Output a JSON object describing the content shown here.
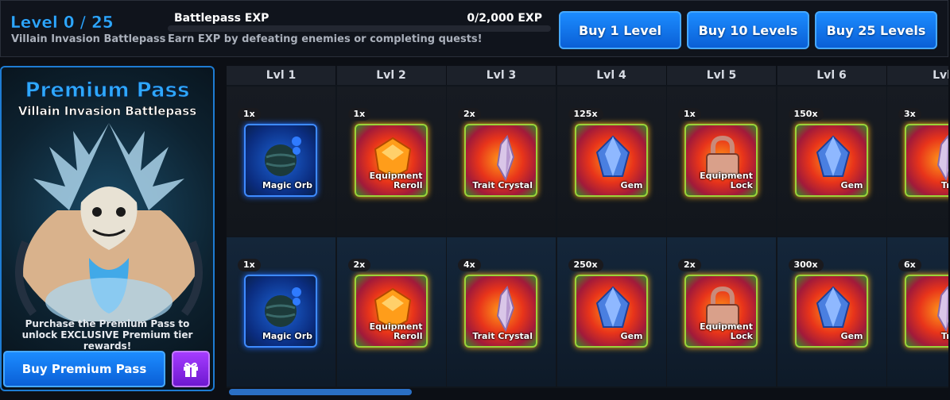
{
  "header": {
    "level_text": "Level 0 / 25",
    "battlepass_name": "Villain Invasion Battlepass",
    "exp_title": "Battlepass EXP",
    "exp_value": "0/2,000 EXP",
    "exp_progress": 0,
    "exp_description": "Earn EXP by defeating enemies or completing quests!",
    "buy_buttons": [
      "Buy 1 Level",
      "Buy 10 Levels",
      "Buy 25 Levels"
    ]
  },
  "premium": {
    "title": "Premium Pass",
    "subtitle": "Villain Invasion Battlepass",
    "description": "Purchase the Premium Pass to unlock EXCLUSIVE Premium tier rewards!",
    "buy_label": "Buy Premium Pass",
    "gift_icon": "gift-icon"
  },
  "colors": {
    "accent": "#2ea8ff",
    "button": "#0a5fd6",
    "gift": "#8a2be2"
  },
  "levels": [
    {
      "label": "Lvl 1",
      "free": {
        "qty": "1x",
        "name": "Magic Orb",
        "icon": "magic-orb-icon",
        "rarity": "blue"
      },
      "premium": {
        "qty": "1x",
        "name": "Magic Orb",
        "icon": "magic-orb-icon",
        "rarity": "blue"
      }
    },
    {
      "label": "Lvl 2",
      "free": {
        "qty": "1x",
        "name": "Equipment Reroll",
        "icon": "equipment-reroll-icon",
        "rarity": "rainbow"
      },
      "premium": {
        "qty": "2x",
        "name": "Equipment Reroll",
        "icon": "equipment-reroll-icon",
        "rarity": "rainbow"
      }
    },
    {
      "label": "Lvl 3",
      "free": {
        "qty": "2x",
        "name": "Trait Crystal",
        "icon": "trait-crystal-icon",
        "rarity": "rainbow"
      },
      "premium": {
        "qty": "4x",
        "name": "Trait Crystal",
        "icon": "trait-crystal-icon",
        "rarity": "rainbow"
      }
    },
    {
      "label": "Lvl 4",
      "free": {
        "qty": "125x",
        "name": "Gem",
        "icon": "gem-icon",
        "rarity": "rainbow"
      },
      "premium": {
        "qty": "250x",
        "name": "Gem",
        "icon": "gem-icon",
        "rarity": "rainbow"
      }
    },
    {
      "label": "Lvl 5",
      "free": {
        "qty": "1x",
        "name": "Equipment Lock",
        "icon": "equipment-lock-icon",
        "rarity": "rainbow"
      },
      "premium": {
        "qty": "2x",
        "name": "Equipment Lock",
        "icon": "equipment-lock-icon",
        "rarity": "rainbow"
      }
    },
    {
      "label": "Lvl 6",
      "free": {
        "qty": "150x",
        "name": "Gem",
        "icon": "gem-icon",
        "rarity": "rainbow"
      },
      "premium": {
        "qty": "300x",
        "name": "Gem",
        "icon": "gem-icon",
        "rarity": "rainbow"
      }
    },
    {
      "label": "Lvl",
      "free": {
        "qty": "3x",
        "name": "Trait C",
        "icon": "trait-crystal-icon",
        "rarity": "rainbow"
      },
      "premium": {
        "qty": "6x",
        "name": "Trait C",
        "icon": "trait-crystal-icon",
        "rarity": "rainbow"
      }
    }
  ]
}
